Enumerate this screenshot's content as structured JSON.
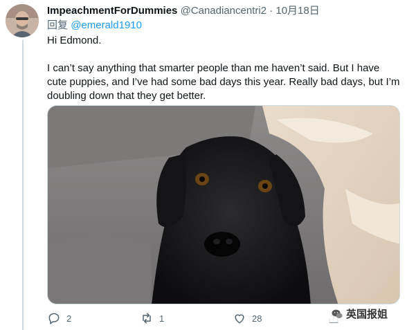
{
  "tweet": {
    "display_name": "ImpeachmentForDummies",
    "handle": "@Canadiancentri2",
    "separator": "·",
    "date": "10月18日",
    "replying_label": "回复",
    "replying_to": "@emerald1910",
    "paragraphs": [
      "Hi Edmond.",
      "I can’t say anything that smarter people than me haven’t said.  But I have cute puppies, and I’ve had some bad days this year. Really bad days, but I’m doubling down that they get better."
    ],
    "media_description_icon": "photo-black-labrador"
  },
  "actions": {
    "reply_count": "2",
    "retweet_count": "1",
    "like_count": "28"
  },
  "watermark": {
    "text": "英国报姐"
  },
  "colors": {
    "accent": "#1d9bf0",
    "secondary_text": "#536471",
    "primary_text": "#0f1419"
  }
}
